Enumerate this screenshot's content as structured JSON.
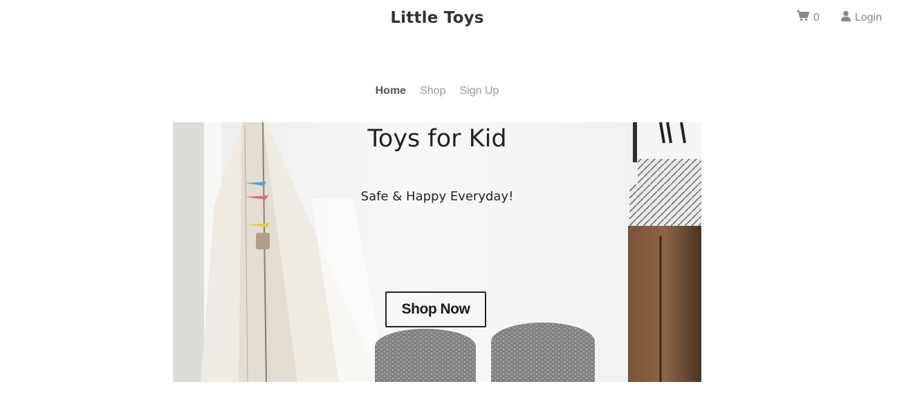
{
  "header": {
    "brand": "Little Toys",
    "cart_count": "0",
    "login_label": "Login"
  },
  "nav": {
    "items": [
      {
        "label": "Home",
        "active": true
      },
      {
        "label": "Shop",
        "active": false
      },
      {
        "label": "Sign Up",
        "active": false
      }
    ]
  },
  "hero": {
    "title": "Toys for Kid",
    "subtitle": "Safe & Happy Everyday!",
    "button_label": "Shop Now"
  },
  "colors": {
    "text_dark": "#333333",
    "nav_muted": "#999999",
    "icon_gray": "#888888"
  }
}
